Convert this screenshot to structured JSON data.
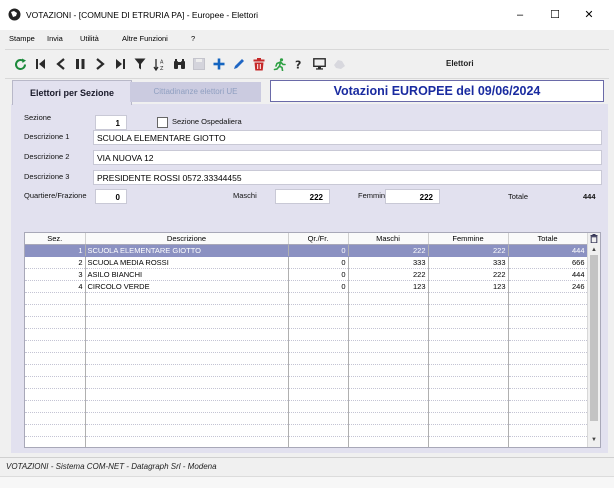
{
  "window": {
    "title": "VOTAZIONI - [COMUNE DI ETRURIA PA] - Europee - Elettori",
    "minimize": "–",
    "maximize": "☐",
    "close": "✕"
  },
  "menu": [
    "Stampe",
    "Invia",
    "Utilità",
    "Altre Funzioni",
    "?"
  ],
  "toolbar": {
    "icons": [
      "refresh-icon",
      "first-record-icon",
      "previous-record-icon",
      "pause-icon",
      "next-record-icon",
      "last-record-icon",
      "filter-icon",
      "sort-az-icon",
      "find-icon",
      "save-icon",
      "add-icon",
      "edit-icon",
      "delete-icon",
      "run-icon",
      "help-icon",
      "monitor-icon",
      "exit-icon"
    ],
    "label": "Elettori"
  },
  "tabs": {
    "active": "Elettori per Sezione",
    "inactive": "Cittadinanze elettori UE"
  },
  "headline": "Votazioni EUROPEE del 09/06/2024",
  "form": {
    "sezione_label": "Sezione",
    "sezione_value": "1",
    "ospedaliera_label": "Sezione Ospedaliera",
    "desc1_label": "Descrizione 1",
    "desc1_value": "SCUOLA ELEMENTARE GIOTTO",
    "desc2_label": "Descrizione 2",
    "desc2_value": "VIA NUOVA 12",
    "desc3_label": "Descrizione 3",
    "desc3_value": "PRESIDENTE ROSSI 0572.33344455",
    "quartiere_label": "Quartiere/Frazione",
    "quartiere_value": "0",
    "maschi_label": "Maschi",
    "maschi_value": "222",
    "femmine_label": "Femmine",
    "femmine_value": "222",
    "totale_label": "Totale",
    "totale_value": "444"
  },
  "grid": {
    "columns": [
      "Sez.",
      "Descrizione",
      "Qr./Fr.",
      "Maschi",
      "Femmine",
      "Totale"
    ],
    "rows": [
      {
        "sez": "1",
        "descrizione": "SCUOLA ELEMENTARE GIOTTO",
        "qr": "0",
        "maschi": "222",
        "femmine": "222",
        "totale": "444"
      },
      {
        "sez": "2",
        "descrizione": "SCUOLA MEDIA ROSSI",
        "qr": "0",
        "maschi": "333",
        "femmine": "333",
        "totale": "666"
      },
      {
        "sez": "3",
        "descrizione": "ASILO BIANCHI",
        "qr": "0",
        "maschi": "222",
        "femmine": "222",
        "totale": "444"
      },
      {
        "sez": "4",
        "descrizione": "CIRCOLO VERDE",
        "qr": "0",
        "maschi": "123",
        "femmine": "123",
        "totale": "246"
      }
    ],
    "selected_row": 0
  },
  "status": "VOTAZIONI - Sistema COM-NET - Datagraph Srl - Modena"
}
